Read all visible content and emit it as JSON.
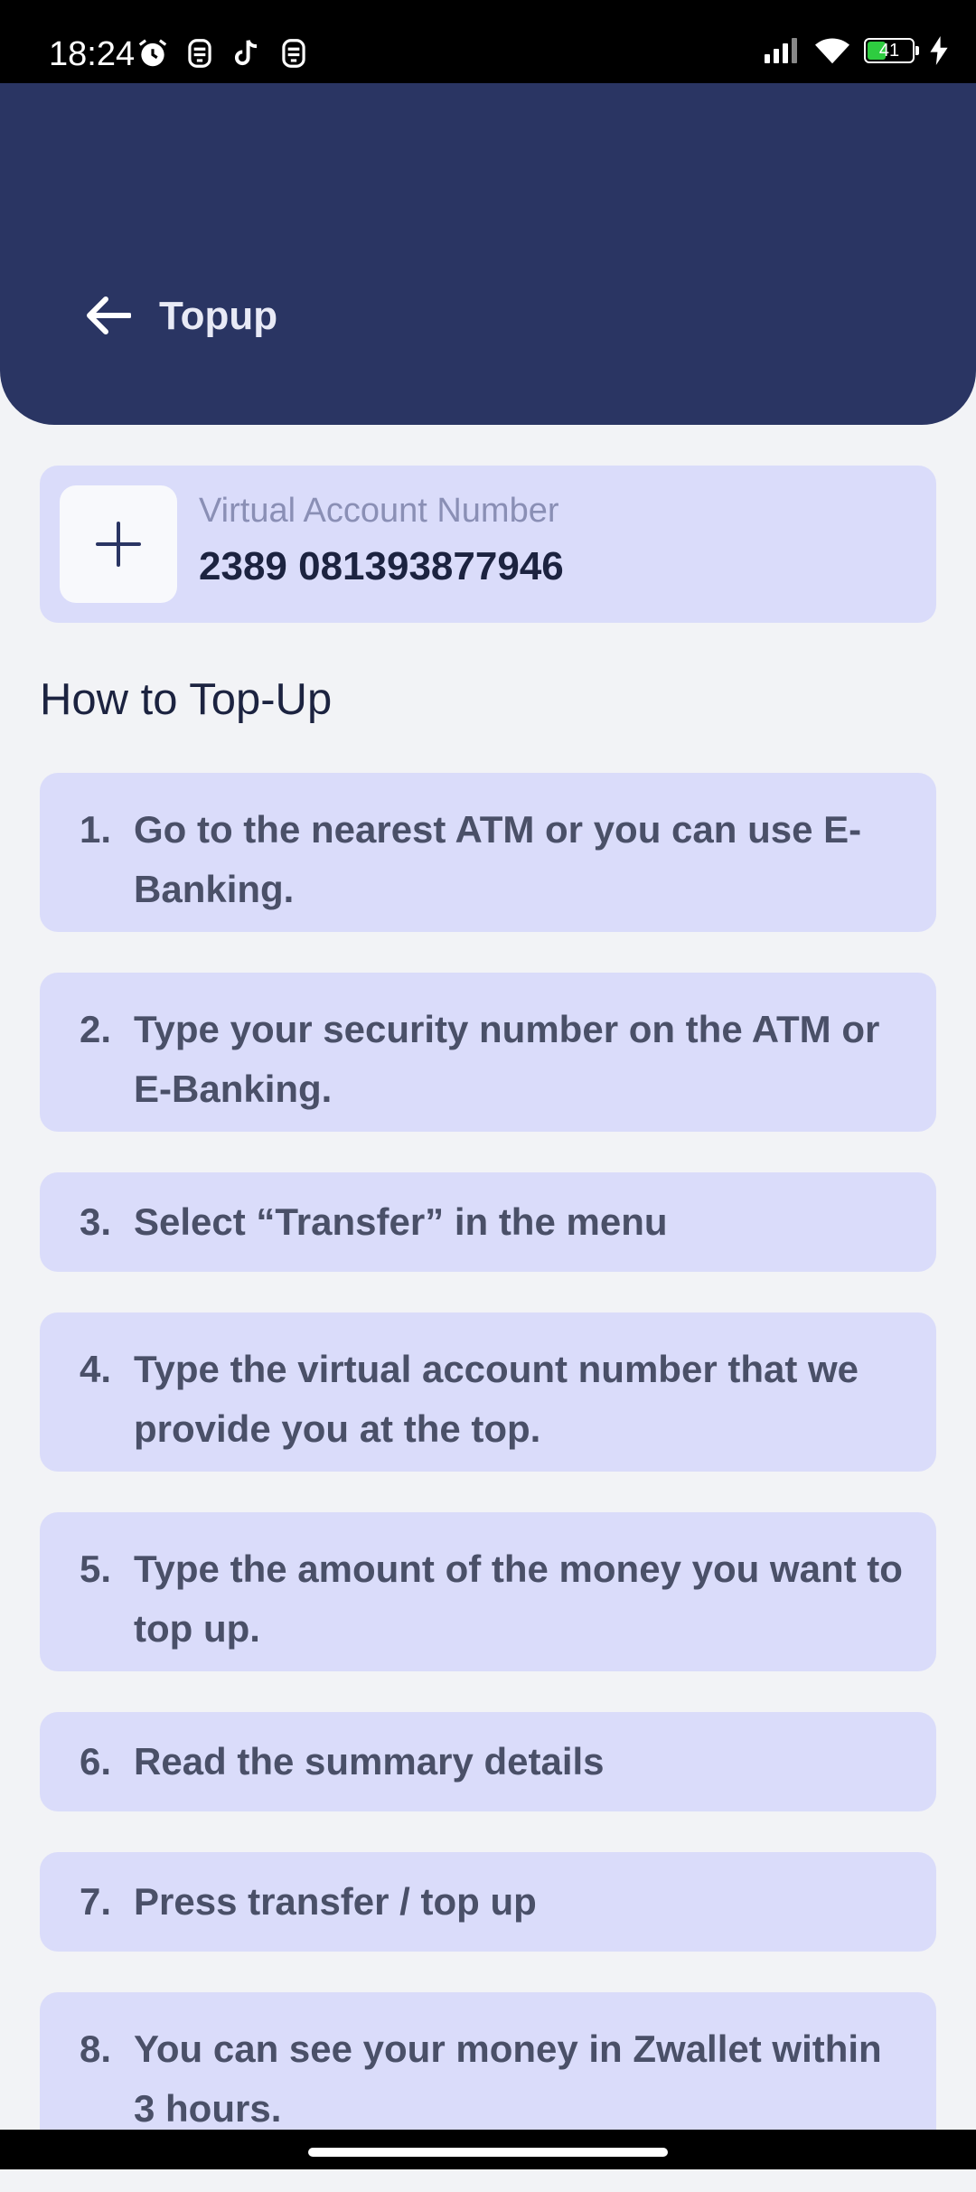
{
  "status_bar": {
    "time": "18:24",
    "left_icons": [
      "alarm-icon",
      "app-notification-icon",
      "tiktok-icon",
      "app-notification-icon"
    ],
    "battery_level": "41",
    "battery_percent": 41,
    "signal_icon": "signal-icon",
    "wifi_icon": "wifi-icon",
    "charging_icon": "charging-icon"
  },
  "header": {
    "title": "Topup",
    "background": "#2A3563"
  },
  "va_card": {
    "label": "Virtual Account Number",
    "number": "2389 081393877946"
  },
  "section_title": "How to Top-Up",
  "steps": [
    {
      "number": "1.",
      "text": "Go to the nearest ATM or you can use E-Banking."
    },
    {
      "number": "2.",
      "text": "Type your security number on the ATM or E-Banking."
    },
    {
      "number": "3.",
      "text": "Select “Transfer” in the menu"
    },
    {
      "number": "4.",
      "text": "Type the virtual account number that we provide you at the top."
    },
    {
      "number": "5.",
      "text": "Type the amount of the money you want to top up."
    },
    {
      "number": "6.",
      "text": "Read the summary details"
    },
    {
      "number": "7.",
      "text": "Press transfer / top up"
    },
    {
      "number": "8.",
      "text": "You can see your money in Zwallet within 3 hours."
    }
  ],
  "colors": {
    "card": "#DADCFA",
    "page": "#F2F3F6",
    "text_dark": "#1C2340",
    "text_step": "#4A5068"
  }
}
